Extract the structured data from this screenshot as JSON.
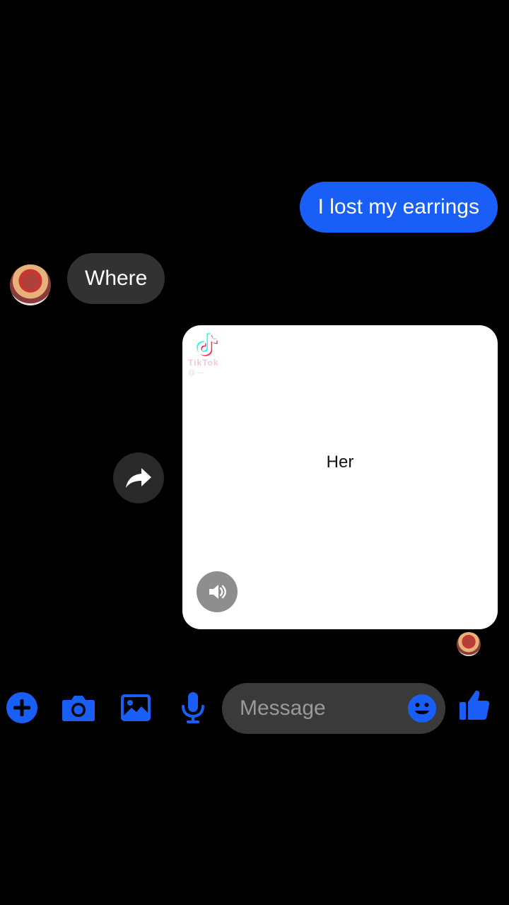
{
  "conversation": {
    "messages": [
      {
        "direction": "outgoing",
        "text": "I lost my earrings"
      },
      {
        "direction": "incoming",
        "text": "Where"
      }
    ],
    "shared_video": {
      "source": "TikTok",
      "watermark_text": "TikTok",
      "watermark_handle": "@ —",
      "caption": "Her"
    }
  },
  "composer": {
    "placeholder": "Message"
  },
  "icons": {
    "add": "plus-circle-icon",
    "camera": "camera-icon",
    "gallery": "image-icon",
    "voice": "microphone-icon",
    "emoji": "smiley-icon",
    "like": "thumbs-up-icon",
    "forward": "share-arrow-icon",
    "sound": "speaker-icon"
  },
  "colors": {
    "background": "#000000",
    "accent": "#1a5ef8",
    "incoming_bubble": "#323232",
    "input_field": "#3a3a3a"
  }
}
